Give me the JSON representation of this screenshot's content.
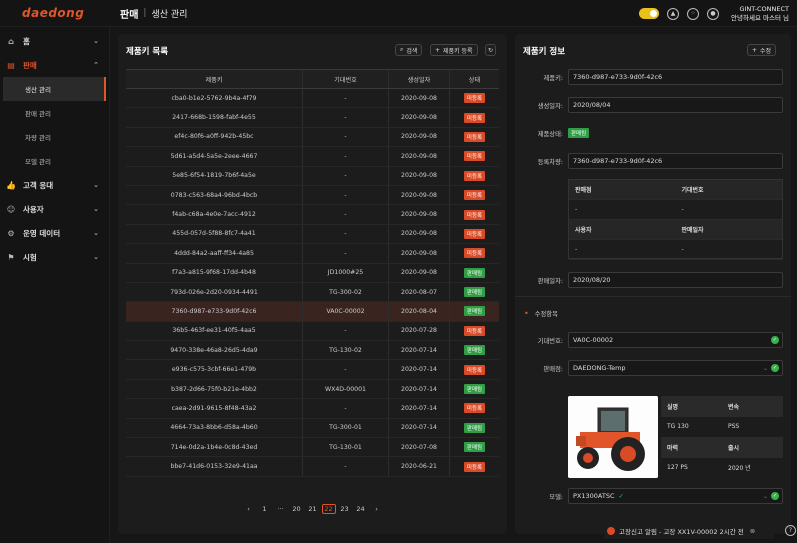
{
  "app": {
    "logo": "daedong",
    "crumb_main": "판매",
    "crumb_sub": "생산 관리",
    "org": "GINT-CONNECT",
    "greeting": "안녕하세요 마스터 님"
  },
  "sidebar": {
    "items": [
      {
        "label": "홈",
        "icon": "home-icon"
      },
      {
        "label": "판매",
        "icon": "sales-icon"
      },
      {
        "label": "고객 응대",
        "icon": "thumb-icon"
      },
      {
        "label": "사용자",
        "icon": "user-icon"
      },
      {
        "label": "운영 데이터",
        "icon": "gear-icon"
      },
      {
        "label": "시험",
        "icon": "flag-icon"
      }
    ],
    "sub_items": [
      "생산 관리",
      "판매 관리",
      "차량 관리",
      "모델 관리"
    ]
  },
  "list": {
    "title": "제품키 목록",
    "search_label": "검색",
    "add_label": "제품키 등록",
    "headers": [
      "제품키",
      "기대번호",
      "생성일자",
      "상태"
    ],
    "rows": [
      {
        "key": "cba0-b1e2-5762-9b4a-4f79",
        "num": "-",
        "date": "2020-09-08",
        "status": "미등록",
        "s": "red"
      },
      {
        "key": "2417-668b-1598-fabf-4e55",
        "num": "-",
        "date": "2020-09-08",
        "status": "미등록",
        "s": "red"
      },
      {
        "key": "ef4c-80f6-a0ff-942b-45bc",
        "num": "-",
        "date": "2020-09-08",
        "status": "미등록",
        "s": "red"
      },
      {
        "key": "5d61-a5d4-5a5e-2eee-4667",
        "num": "-",
        "date": "2020-09-08",
        "status": "미등록",
        "s": "red"
      },
      {
        "key": "5e85-6f54-1819-7b6f-4a5e",
        "num": "-",
        "date": "2020-09-08",
        "status": "미등록",
        "s": "red"
      },
      {
        "key": "0783-c563-68a4-96bd-4bcb",
        "num": "-",
        "date": "2020-09-08",
        "status": "미등록",
        "s": "red"
      },
      {
        "key": "f4ab-c68a-4e0e-7acc-4912",
        "num": "-",
        "date": "2020-09-08",
        "status": "미등록",
        "s": "red"
      },
      {
        "key": "455d-057d-5f88-8fc7-4a41",
        "num": "-",
        "date": "2020-09-08",
        "status": "미등록",
        "s": "red"
      },
      {
        "key": "4ddd-84a2-aaff-ff34-4a85",
        "num": "-",
        "date": "2020-09-08",
        "status": "미등록",
        "s": "red"
      },
      {
        "key": "f7a3-a815-9f68-17dd-4b48",
        "num": "JD1000#25",
        "date": "2020-09-08",
        "status": "판매됨",
        "s": "green"
      },
      {
        "key": "793d-026e-2d20-0934-4491",
        "num": "TG-300-02",
        "date": "2020-08-07",
        "status": "판매됨",
        "s": "green"
      },
      {
        "key": "7360-d987-e733-9d0f-42c6",
        "num": "VA0C-00002",
        "date": "2020-08-04",
        "status": "판매됨",
        "s": "green"
      },
      {
        "key": "36b5-463f-ee31-40f5-4aa5",
        "num": "-",
        "date": "2020-07-28",
        "status": "미등록",
        "s": "red"
      },
      {
        "key": "9470-338e-46a8-26d5-4da9",
        "num": "TG-130-02",
        "date": "2020-07-14",
        "status": "판매됨",
        "s": "green"
      },
      {
        "key": "e936-c575-3cbf-66e1-479b",
        "num": "-",
        "date": "2020-07-14",
        "status": "미등록",
        "s": "red"
      },
      {
        "key": "b387-2d66-75f0-b21e-4bb2",
        "num": "WX4D-00001",
        "date": "2020-07-14",
        "status": "판매됨",
        "s": "green"
      },
      {
        "key": "caea-2d91-9615-8f48-43a2",
        "num": "-",
        "date": "2020-07-14",
        "status": "미등록",
        "s": "red"
      },
      {
        "key": "4664-73a3-8bb6-d58a-4b60",
        "num": "TG-300-01",
        "date": "2020-07-14",
        "status": "판매됨",
        "s": "green"
      },
      {
        "key": "714e-0d2a-1b4e-0c8d-43ed",
        "num": "TG-130-01",
        "date": "2020-07-08",
        "status": "판매됨",
        "s": "green"
      },
      {
        "key": "bbe7-41d6-0153-32e9-41aa",
        "num": "-",
        "date": "2020-06-21",
        "status": "미등록",
        "s": "red"
      }
    ],
    "selected_index": 11,
    "pages": [
      "‹",
      "1",
      "···",
      "20",
      "21",
      "22",
      "23",
      "24",
      "›"
    ],
    "current_page": "22"
  },
  "detail": {
    "title": "제품키 정보",
    "edit_label": "수정",
    "product_key_label": "제품키:",
    "product_key": "7360-d987-e733-9d0f-42c6",
    "created_label": "생성일자:",
    "created": "2020/08/04",
    "state_label": "제품상태:",
    "state": "판매됨",
    "vehicle_label": "등록차량:",
    "vehicle": "7360-d987-e733-9d0f-42c6",
    "sub_table": {
      "h1": "판매점",
      "h2": "기대번호",
      "v1": "-",
      "v2": "-",
      "h3": "사용자",
      "h4": "판매일자",
      "v3": "-",
      "v4": "-"
    },
    "sale_date_label": "판매일자:",
    "sale_date": "2020/08/20",
    "edit_section": "수정항목",
    "machine_no_label": "기대번호:",
    "machine_no": "VA0C-00002",
    "dealer_label": "판매점:",
    "dealer": "DAEDONG-Temp",
    "spec": {
      "h1": "실명",
      "h2": "변속",
      "v1": "TG 130",
      "v2": "PSS",
      "h3": "마력",
      "h4": "출시",
      "v3": "127 PS",
      "v4": "2020 년"
    },
    "model_label": "모델:",
    "model": "PX1300ATSC"
  },
  "toast": {
    "text": "고장신고 알림 - 고장  XX1V-00002  2시간 전"
  },
  "colors": {
    "accent": "#e2552b",
    "green": "#2f9e44",
    "red": "#d94a26"
  }
}
